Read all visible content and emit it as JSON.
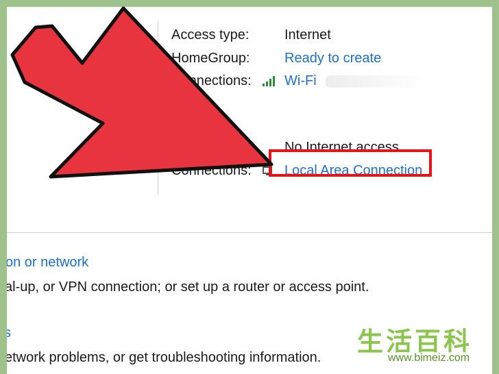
{
  "network": {
    "access_type_label": "Access type:",
    "access_type_value": "Internet",
    "homegroup_label": "HomeGroup:",
    "homegroup_value": "Ready to create",
    "connections_label": "Connections:",
    "wifi_value": "Wi-Fi",
    "no_internet_text": "No Internet access",
    "connections2_label": "Connections:",
    "local_area_value": "Local Area Connection"
  },
  "tasks": {
    "setup_link": "on or network",
    "setup_desc": "al-up, or VPN connection; or set up a router or access point.",
    "troubleshoot_link": "s",
    "troubleshoot_desc": "etwork problems, or get troubleshooting information."
  },
  "watermark": {
    "chars": "生活百科",
    "url": "www.bimeiz.com"
  },
  "colors": {
    "link": "#1f6fc7",
    "arrow": "#e8343f",
    "highlight_box": "#e8121b",
    "frame": "#9fc28c"
  }
}
